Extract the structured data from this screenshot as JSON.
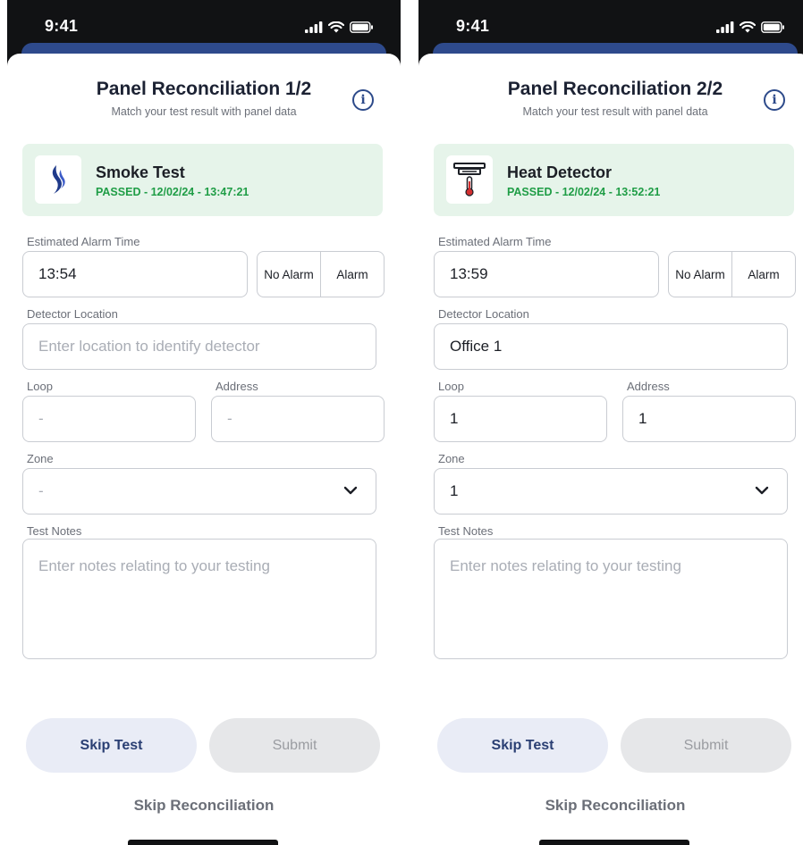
{
  "status_bar": {
    "time": "9:41"
  },
  "colors": {
    "accent": "#2d4a8a",
    "passed": "#1f9d46",
    "card_bg": "#e6f4ea",
    "skip_bg": "#e9ecf6",
    "submit_bg": "#e6e7e9"
  },
  "screens": [
    {
      "header": {
        "title": "Panel Reconciliation 1/2",
        "subtitle": "Match your test result with panel data"
      },
      "result": {
        "icon": "smoke-flame-icon",
        "title": "Smoke Test",
        "status": "PASSED - 12/02/24 - 13:47:21"
      },
      "alarm_time": {
        "label": "Estimated Alarm Time",
        "value": "13:54",
        "toggle": [
          "No Alarm",
          "Alarm"
        ]
      },
      "location": {
        "label": "Detector Location",
        "value": "",
        "placeholder": "Enter location to identify detector"
      },
      "loop": {
        "label": "Loop",
        "value": "-"
      },
      "address": {
        "label": "Address",
        "value": "-"
      },
      "zone": {
        "label": "Zone",
        "value": "-"
      },
      "notes": {
        "label": "Test Notes",
        "placeholder": "Enter notes relating to your testing"
      },
      "buttons": {
        "skip": "Skip Test",
        "submit": "Submit",
        "skip_all": "Skip Reconciliation"
      }
    },
    {
      "header": {
        "title": "Panel Reconciliation 2/2",
        "subtitle": "Match your test result with panel data"
      },
      "result": {
        "icon": "heat-detector-icon",
        "title": "Heat Detector",
        "status": "PASSED - 12/02/24 - 13:52:21"
      },
      "alarm_time": {
        "label": "Estimated Alarm Time",
        "value": "13:59",
        "toggle": [
          "No Alarm",
          "Alarm"
        ]
      },
      "location": {
        "label": "Detector Location",
        "value": "Office 1",
        "placeholder": ""
      },
      "loop": {
        "label": "Loop",
        "value": "1"
      },
      "address": {
        "label": "Address",
        "value": "1"
      },
      "zone": {
        "label": "Zone",
        "value": "1"
      },
      "notes": {
        "label": "Test Notes",
        "placeholder": "Enter notes relating to your testing"
      },
      "buttons": {
        "skip": "Skip Test",
        "submit": "Submit",
        "skip_all": "Skip Reconciliation"
      }
    }
  ]
}
